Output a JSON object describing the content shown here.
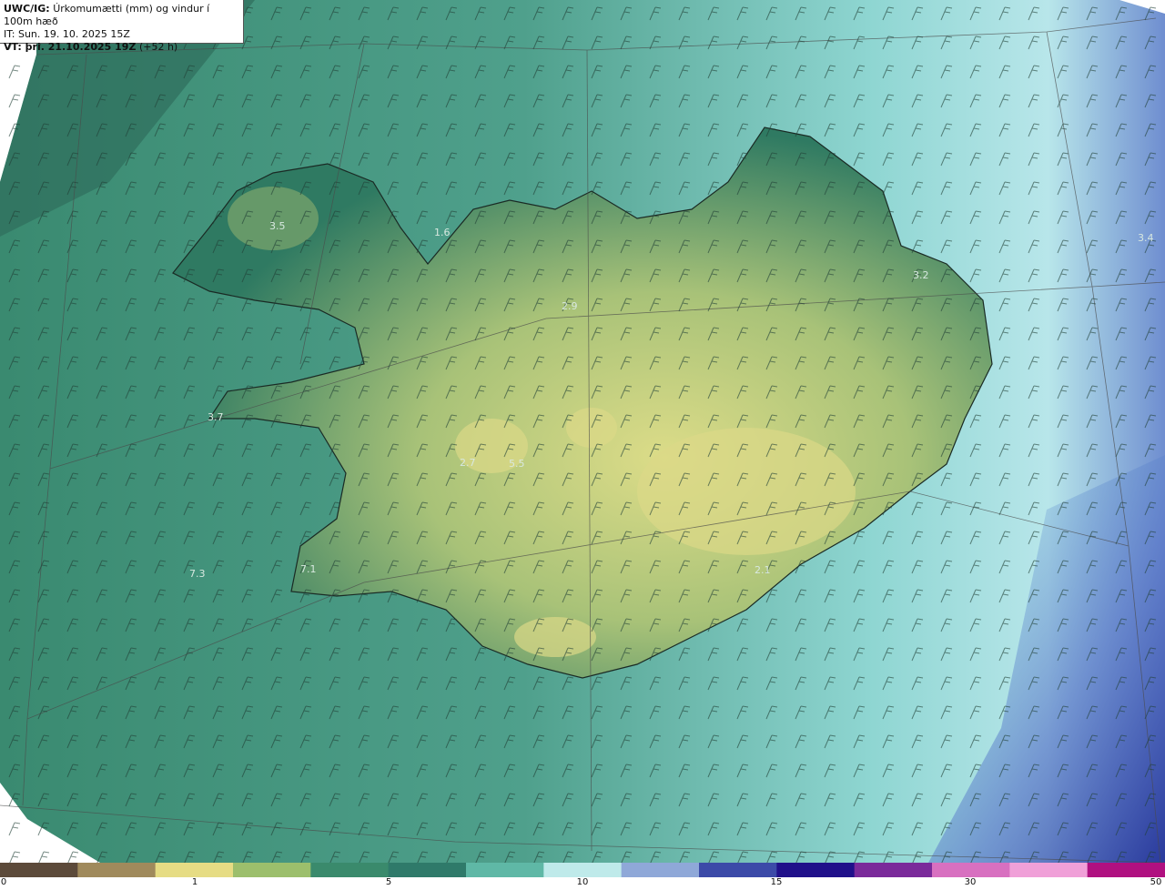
{
  "header": {
    "product": "UWC/IG:",
    "description": "Úrkomumætti (mm) og vindur í 100m hæð",
    "init_time": "IT: Sun. 19. 10. 2025 15Z",
    "valid_label": "VT: þri. 21.10.2025 19Z",
    "valid_offset": "(+52 h)"
  },
  "map_labels": [
    {
      "text": "3.5"
    },
    {
      "text": "1.6"
    },
    {
      "text": "2.9"
    },
    {
      "text": "3.2"
    },
    {
      "text": "3.4"
    },
    {
      "text": "3.7"
    },
    {
      "text": "2.7"
    },
    {
      "text": "5.5"
    },
    {
      "text": "7.3"
    },
    {
      "text": "7.1"
    },
    {
      "text": "2.1"
    }
  ],
  "legend": {
    "ticks": [
      "0",
      "1",
      "5",
      "10",
      "15",
      "30",
      "50"
    ],
    "colors": [
      "#5c4a3a",
      "#a08a5c",
      "#e6dc84",
      "#9cbf6c",
      "#3a8a6c",
      "#2f7a6a",
      "#5fb8a6",
      "#bfeaea",
      "#8fa8d8",
      "#3c4aa8",
      "#20108a",
      "#7a2a9a",
      "#d870c0",
      "#f0a0d8",
      "#b01080"
    ]
  },
  "colors": {
    "land_low": "#2f7a62",
    "land_high": "#d6d884",
    "sea": "#4fa08a",
    "sea_east": "#a8e0e0",
    "heavy": "#3040a0"
  }
}
